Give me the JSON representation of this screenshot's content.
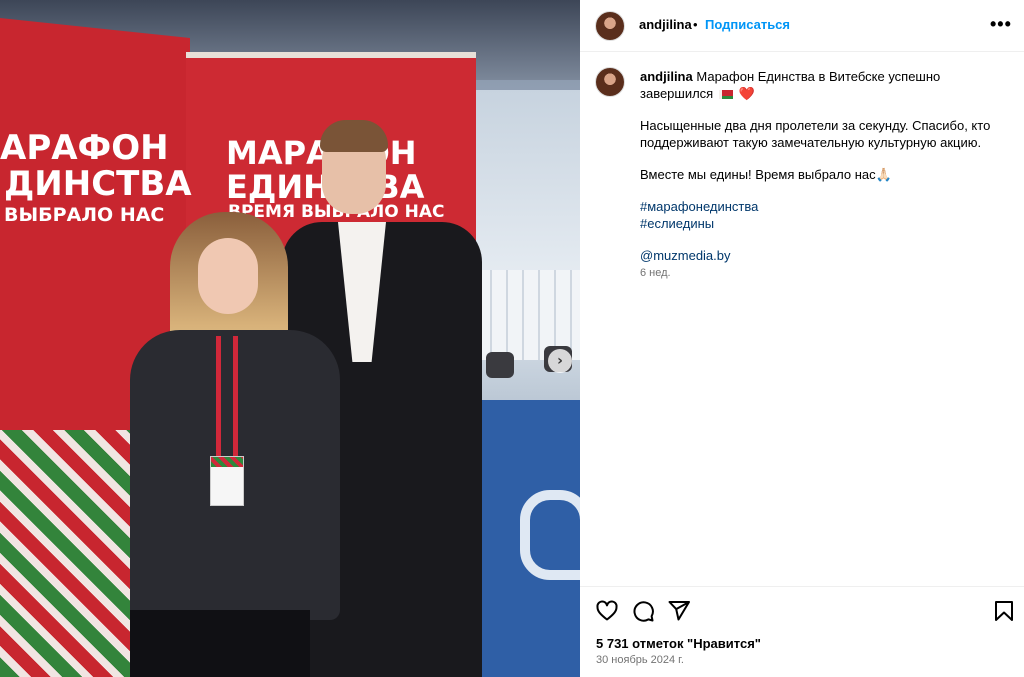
{
  "photo": {
    "banner_left": {
      "line1": "АРАФОН",
      "line2": "ДИНСТВА",
      "line3": "ВЫБРАЛО НАС"
    },
    "banner_right": {
      "line1": "МАРАФОН",
      "line2": "ЕДИНСТВА",
      "line3": "ВРЕМЯ ВЫБРАЛО НАС"
    },
    "next_arrow_icon": "chevron-right-icon",
    "next_arrow_glyph": "›"
  },
  "header": {
    "username": "andjilina",
    "separator": "•",
    "follow_label": "Подписаться",
    "more_glyph": "•••"
  },
  "caption": {
    "username": "andjilina",
    "line1": "Марафон Единства в Витебске успешно завершился",
    "heart": "❤️",
    "paragraph2": "Насыщенные два дня пролетели за секунду. Спасибо, кто поддерживают такую замечательную культурную акцию.",
    "paragraph3": "Вместе мы едины! Время выбрало нас",
    "pray_emoji": "🙏🏻",
    "hashtag1": "#марафонединства",
    "hashtag2": "#еслиедины",
    "mention": "@muzmedia.by",
    "time_ago": "6 нед."
  },
  "footer": {
    "likes": "5 731 отметок \"Нравится\"",
    "date": "30 ноябрь 2024 г."
  },
  "colors": {
    "follow": "#0095f6",
    "link": "#00376b",
    "banner_red": "#c8262f",
    "ornament_green": "#2c8a3c"
  }
}
